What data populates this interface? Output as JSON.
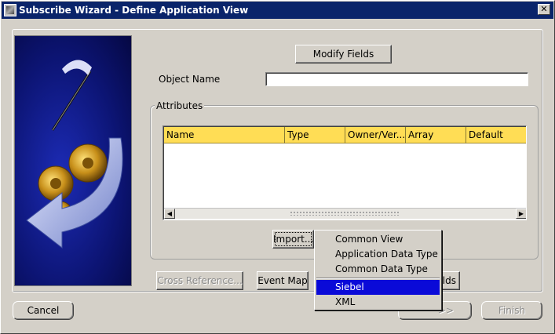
{
  "window": {
    "title": "Subscribe Wizard  - Define Application View",
    "close_glyph": "✕"
  },
  "main": {
    "modify_fields_label": "Modify Fields",
    "object_name_label": "Object Name",
    "object_name_value": "",
    "attributes_legend": "Attributes",
    "table": {
      "columns": [
        "Name",
        "Type",
        "Owner/Ver...",
        "Array",
        "Default"
      ],
      "rows": []
    },
    "import_label": "Import...",
    "cross_reference_label": "Cross Reference...",
    "event_map_label": "Event Map",
    "fields_partial_label": "ields"
  },
  "context_menu": {
    "items": [
      "Common View",
      "Application Data Type",
      "Common Data Type",
      "Siebel",
      "XML"
    ],
    "selected": "Siebel"
  },
  "footer": {
    "cancel_label": "Cancel",
    "next_glyph": ">>",
    "finish_label": "Finish"
  },
  "icons": {
    "art": "wizard-banner-gears-arrow-icon",
    "app": "app-window-icon",
    "close": "close-icon"
  },
  "colors": {
    "titlebar": "#0a246a",
    "table_header": "#ffdd55",
    "menu_selection": "#0a0ad8",
    "art_background": "#0c1473"
  }
}
